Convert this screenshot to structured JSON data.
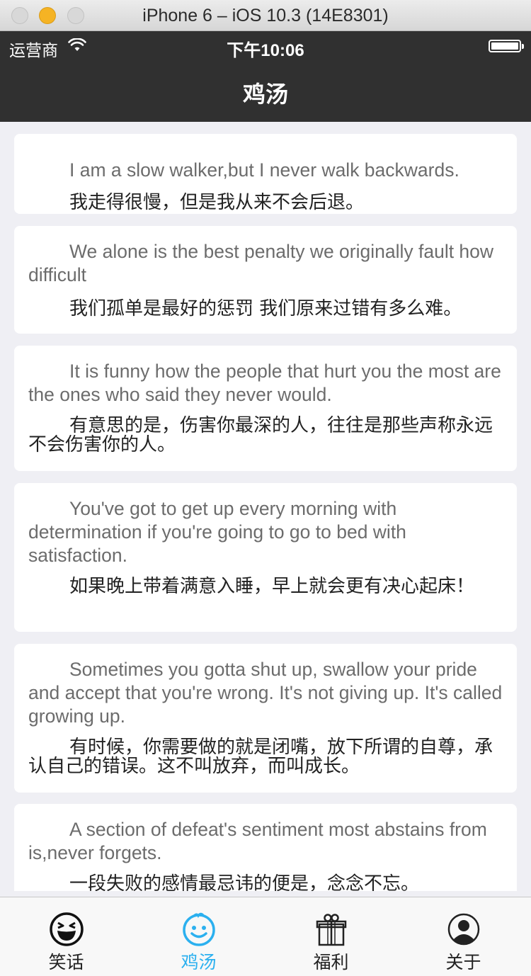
{
  "window": {
    "title": "iPhone 6 – iOS 10.3 (14E8301)"
  },
  "status_bar": {
    "carrier": "运营商",
    "time": "下午10:06"
  },
  "nav": {
    "title": "鸡汤"
  },
  "quotes": [
    {
      "en": "I am a slow walker,but I never walk backwards.",
      "cn": "我走得很慢，但是我从来不会后退。"
    },
    {
      "en": "We alone is the best penalty we originally fault how difficult",
      "cn": "我们孤单是最好的惩罚 我们原来过错有多么难。"
    },
    {
      "en": "It is funny how the people that hurt you the most are the ones who said they never would.",
      "cn": "有意思的是，伤害你最深的人，往往是那些声称永远不会伤害你的人。"
    },
    {
      "en": "You've got to get up every morning with determination if you're going to go to bed with satisfaction.",
      "cn": "如果晚上带着满意入睡，早上就会更有决心起床！"
    },
    {
      "en": "Sometimes you gotta shut up, swallow your pride and accept that you're wrong. It's not giving up. It's called growing up.",
      "cn": "有时候，你需要做的就是闭嘴，放下所谓的自尊，承认自己的错误。这不叫放弃，而叫成长。"
    },
    {
      "en": "A section of defeat's sentiment most abstains from is,never forgets.",
      "cn": "一段失败的感情最忌讳的便是，念念不忘。"
    }
  ],
  "tabbar": {
    "active_color": "#2bb0ef",
    "tabs": [
      {
        "label": "笑话",
        "icon": "laughing-face-icon"
      },
      {
        "label": "鸡汤",
        "icon": "smiley-face-icon"
      },
      {
        "label": "福利",
        "icon": "gift-icon"
      },
      {
        "label": "关于",
        "icon": "user-icon"
      }
    ]
  }
}
